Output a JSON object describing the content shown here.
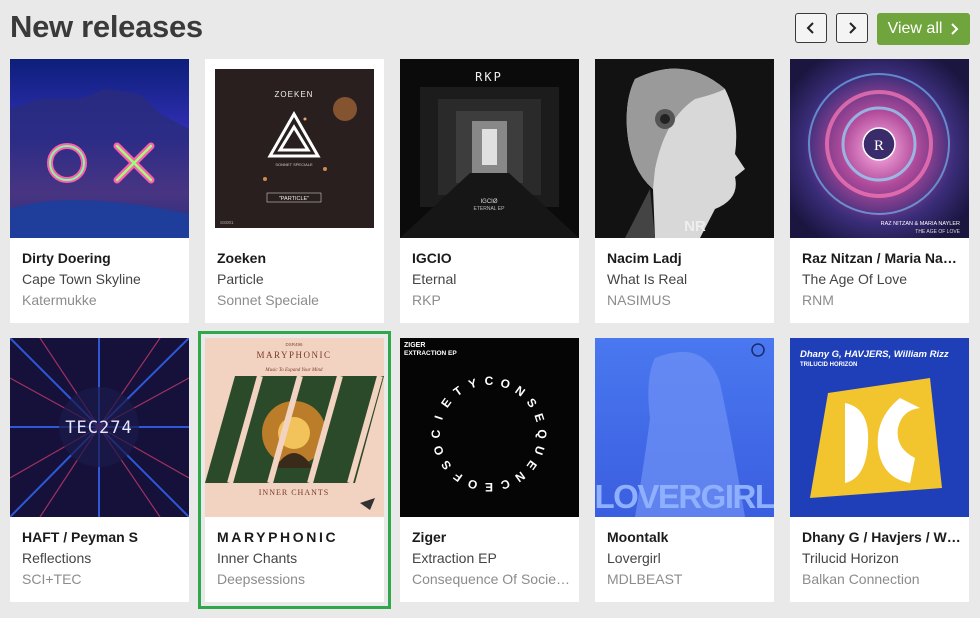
{
  "header": {
    "title": "New releases",
    "view_all_label": "View all",
    "prev_icon": "chevron-left-icon",
    "next_icon": "chevron-right-icon",
    "accent": "#70a43c"
  },
  "releases": [
    {
      "artist": "Dirty Doering",
      "track": "Cape Town Skyline",
      "label": "Katermukke",
      "art_text": "OX"
    },
    {
      "artist": "Zoeken",
      "track": "Particle",
      "label": "Sonnet Speciale",
      "art_text": "ZOEKEN",
      "art_sub": "\"PARTICLE\"",
      "art_brand": "SONNET SPECIALE",
      "art_code": "SS001"
    },
    {
      "artist": "IGCIO",
      "track": "Eternal",
      "label": "RKP",
      "art_text": "RKP",
      "art_sub": "IGCIØ",
      "art_sub2": "ETERNAL EP"
    },
    {
      "artist": "Nacim Ladj",
      "track": "What Is Real",
      "label": "NASIMUS",
      "art_text": "NR"
    },
    {
      "artist": "Raz Nitzan / Maria Na…",
      "track": "The Age Of Love",
      "label": "RNM",
      "art_text": "RAZ NITZAN & MARIA NAYLER",
      "art_sub": "THE AGE OF LOVE"
    },
    {
      "artist": "HAFT / Peyman S",
      "track": "Reflections",
      "label": "SCI+TEC",
      "art_text": "TEC274"
    },
    {
      "artist": "MARYPHONIC",
      "track": "Inner Chants",
      "label": "Deepsessions",
      "art_text": "MARYPHONIC",
      "art_sub": "Music To Expand Your Mind",
      "art_sub2": "INNER CHANTS",
      "art_code": "DSR496"
    },
    {
      "artist": "Ziger",
      "track": "Extraction EP",
      "label": "Consequence Of Socie…",
      "art_text": "ZIGER",
      "art_sub": "EXTRACTION EP",
      "art_ring": "CONSEQUENCEOFSOCIETY"
    },
    {
      "artist": "Moontalk",
      "track": "Lovergirl",
      "label": "MDLBEAST",
      "art_text": "LOVERGIRL"
    },
    {
      "artist": "Dhany G / Havjers / W…",
      "track": "Trilucid Horizon",
      "label": "Balkan Connection",
      "art_text": "Dhany G, HAVJERS, William Rizz",
      "art_sub": "TRILUCID HORIZON"
    }
  ]
}
